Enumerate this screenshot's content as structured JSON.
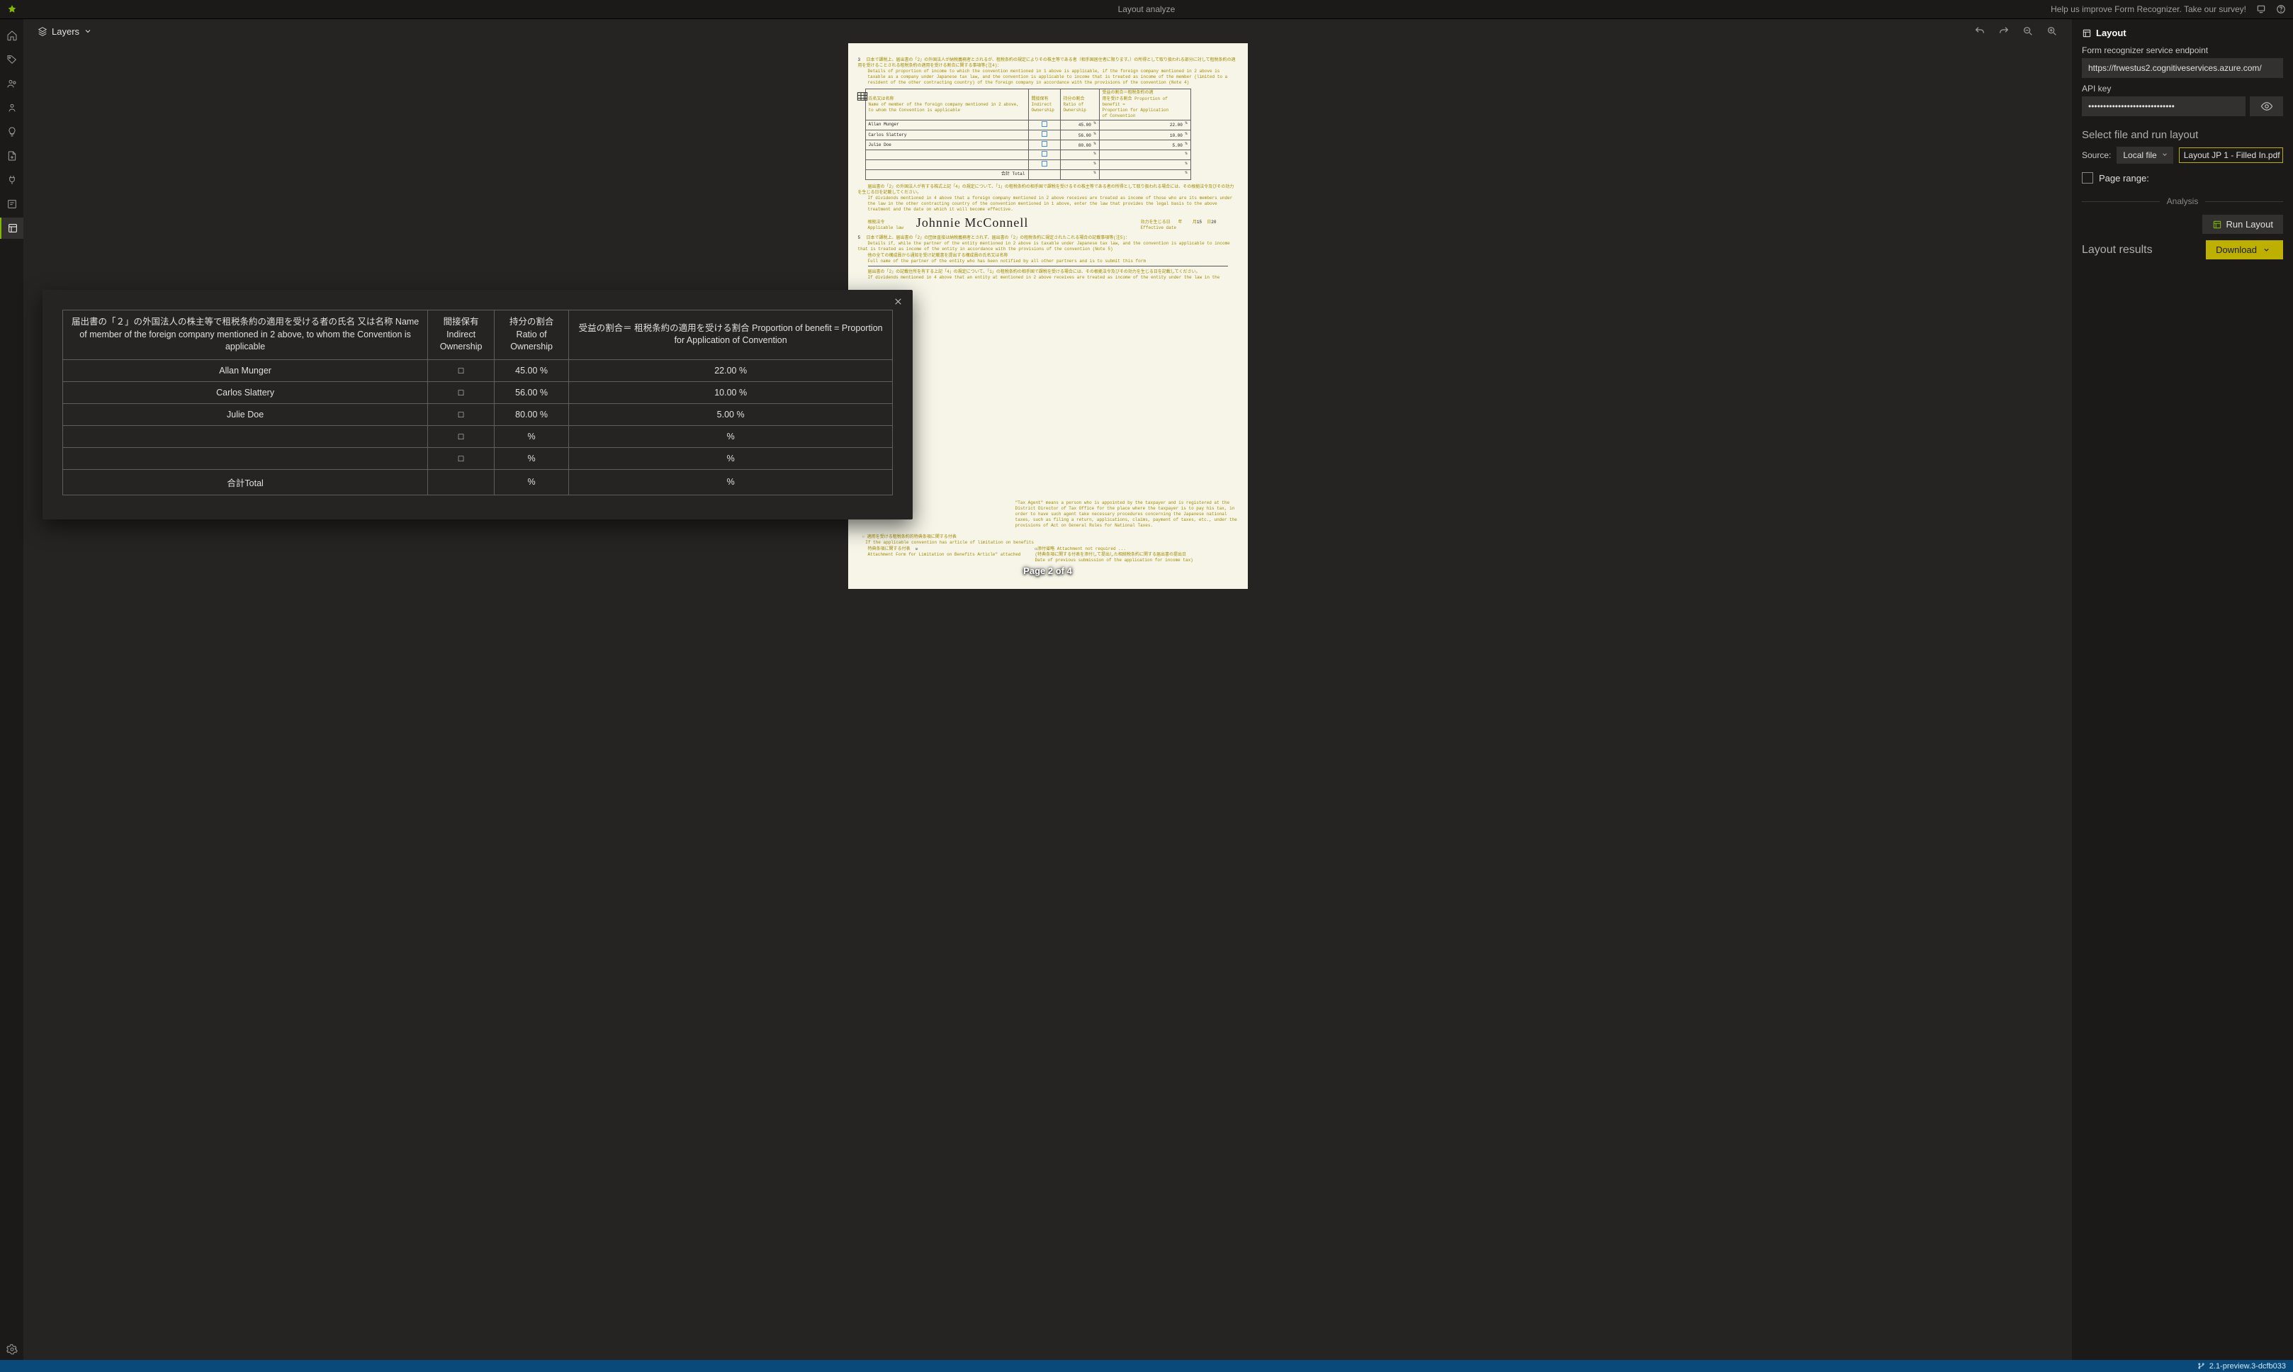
{
  "titlebar": {
    "app_title": "Layout analyze",
    "survey_link": "Help us improve Form Recognizer. Take our survey!"
  },
  "leftrail": {
    "items": [
      {
        "name": "home",
        "active": false
      },
      {
        "name": "tag",
        "active": false
      },
      {
        "name": "group",
        "active": false
      },
      {
        "name": "person",
        "active": false
      },
      {
        "name": "lightbulb",
        "active": false
      },
      {
        "name": "new-doc",
        "active": false
      },
      {
        "name": "plug",
        "active": false
      },
      {
        "name": "prebuilt",
        "active": false
      },
      {
        "name": "layout",
        "active": true
      }
    ],
    "settings": "settings"
  },
  "canvas": {
    "layers_label": "Layers",
    "page_indicator": "Page 2 of 4",
    "signature": "Johnnie McConnell",
    "form_table": {
      "headers": [
        "氏名又は名称 / Name of member of the foreign company mentioned in 2 above, to whom the Convention is applicable",
        "Indirect Ownership",
        "Ratio of Ownership",
        "Proportion of benefit = Proportion for Application of Convention"
      ],
      "rows": [
        {
          "name": "Allan Munger",
          "ratio": "45.00",
          "benefit": "22.00"
        },
        {
          "name": "Carlos Slattery",
          "ratio": "56.00",
          "benefit": "10.00"
        },
        {
          "name": "Julie Doe",
          "ratio": "80.00",
          "benefit": "5.00"
        }
      ],
      "total_label": "合計 Total"
    },
    "effective_date": {
      "label": "Effective date",
      "mm": "15",
      "dd": "20"
    }
  },
  "rightpanel": {
    "section_title": "Layout",
    "endpoint_label": "Form recognizer service endpoint",
    "endpoint_value": "https://frwestus2.cognitiveservices.azure.com/",
    "apikey_label": "API key",
    "apikey_masked": "•••••••••••••••••••••••••••••",
    "select_head": "Select file and run layout",
    "source_label": "Source:",
    "source_dropdown": "Local file",
    "file_name": "Layout JP 1 - Filled In.pdf",
    "page_range_label": "Page range:",
    "analysis_divider": "Analysis",
    "run_label": "Run Layout",
    "results_head": "Layout results",
    "download_label": "Download"
  },
  "modal": {
    "headers": {
      "name": "届出書の「２」の外国法人の株主等で租税条約の適用を受ける者の氏名 又は名称 Name of member of the foreign company mentioned in 2 above, to whom the Convention is applicable",
      "indirect": "間接保有 Indirect Ownership",
      "ratio": "持分の割合 Ratio of Ownership",
      "benefit": "受益の割合＝ 租税条約の適用を受ける割合 Proportion of benefit = Proportion for Application of Convention"
    },
    "rows": [
      {
        "name": "Allan Munger",
        "indirect": "□",
        "ratio": "45.00 %",
        "benefit": "22.00 %"
      },
      {
        "name": "Carlos Slattery",
        "indirect": "□",
        "ratio": "56.00 %",
        "benefit": "10.00 %"
      },
      {
        "name": "Julie Doe",
        "indirect": "□",
        "ratio": "80.00 %",
        "benefit": "5.00 %"
      },
      {
        "name": "",
        "indirect": "□",
        "ratio": "%",
        "benefit": "%"
      },
      {
        "name": "",
        "indirect": "□",
        "ratio": "%",
        "benefit": "%"
      },
      {
        "name": "合計Total",
        "indirect": "",
        "ratio": "%",
        "benefit": "%"
      }
    ]
  },
  "statusbar": {
    "version": "2.1-preview.3-dcfb033"
  }
}
